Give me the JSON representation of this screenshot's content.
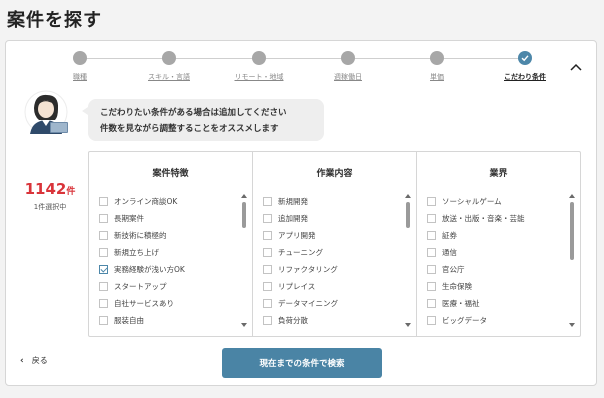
{
  "page": {
    "title": "案件を探す"
  },
  "stepper": {
    "steps": [
      {
        "label": "職種",
        "done": true
      },
      {
        "label": "スキル・言語",
        "done": true
      },
      {
        "label": "リモート・地域",
        "done": true
      },
      {
        "label": "週稼働日",
        "done": true
      },
      {
        "label": "単価",
        "done": true
      },
      {
        "label": "こだわり条件",
        "active": true
      }
    ]
  },
  "intro": {
    "message_line1": "こだわりたい条件がある場合は追加してください",
    "message_line2": "件数を見ながら調整することをオススメします"
  },
  "counter": {
    "count": "1142",
    "unit": "件",
    "selected": "1件選択中"
  },
  "filters": {
    "columns": [
      {
        "title": "案件特徴",
        "items": [
          {
            "label": "オンライン商談OK",
            "checked": false
          },
          {
            "label": "長期案件",
            "checked": false
          },
          {
            "label": "新技術に積極的",
            "checked": false
          },
          {
            "label": "新規立ち上げ",
            "checked": false
          },
          {
            "label": "実務経験が浅い方OK",
            "checked": true
          },
          {
            "label": "スタートアップ",
            "checked": false
          },
          {
            "label": "自社サービスあり",
            "checked": false
          },
          {
            "label": "服装自由",
            "checked": false
          }
        ]
      },
      {
        "title": "作業内容",
        "items": [
          {
            "label": "新規開発",
            "checked": false
          },
          {
            "label": "追加開発",
            "checked": false
          },
          {
            "label": "アプリ開発",
            "checked": false
          },
          {
            "label": "チューニング",
            "checked": false
          },
          {
            "label": "リファクタリング",
            "checked": false
          },
          {
            "label": "リプレイス",
            "checked": false
          },
          {
            "label": "データマイニング",
            "checked": false
          },
          {
            "label": "負荷分散",
            "checked": false
          }
        ]
      },
      {
        "title": "業界",
        "items": [
          {
            "label": "ソーシャルゲーム",
            "checked": false
          },
          {
            "label": "放送・出版・音楽・芸能",
            "checked": false
          },
          {
            "label": "証券",
            "checked": false
          },
          {
            "label": "通信",
            "checked": false
          },
          {
            "label": "官公庁",
            "checked": false
          },
          {
            "label": "生命保険",
            "checked": false
          },
          {
            "label": "医療・福祉",
            "checked": false
          },
          {
            "label": "ビッグデータ",
            "checked": false
          }
        ]
      }
    ]
  },
  "footer": {
    "back_label": "戻る",
    "search_label": "現在までの条件で検索"
  },
  "colors": {
    "accent": "#4a84a5",
    "count": "#d9343a",
    "inactive_dot": "#a7a7a7"
  }
}
